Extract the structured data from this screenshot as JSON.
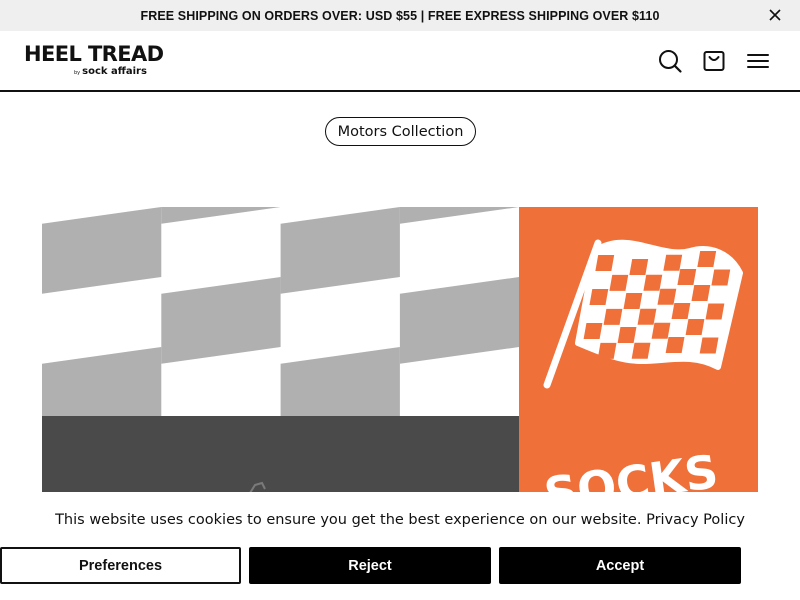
{
  "announcement": {
    "text": "FREE SHIPPING ON ORDERS OVER: USD $55 | FREE EXPRESS SHIPPING OVER $110",
    "close_icon": "close-icon"
  },
  "header": {
    "logo_main": "HEEL TREAD",
    "logo_by": "by",
    "logo_sub": "sock affairs",
    "icons": [
      "search-icon",
      "cart-icon",
      "menu-icon"
    ]
  },
  "collection": {
    "label": "Motors Collection"
  },
  "banner": {
    "colors": {
      "checker_gray": "#b0b0b0",
      "dark_gray": "#4a4a4a",
      "orange": "#f0703a"
    },
    "flag_text": "SOCKS"
  },
  "cookie": {
    "message": "This website uses cookies to ensure you get the best experience on our website.",
    "policy_link": "Privacy Policy",
    "buttons": {
      "preferences": "Preferences",
      "reject": "Reject",
      "accept": "Accept"
    }
  }
}
